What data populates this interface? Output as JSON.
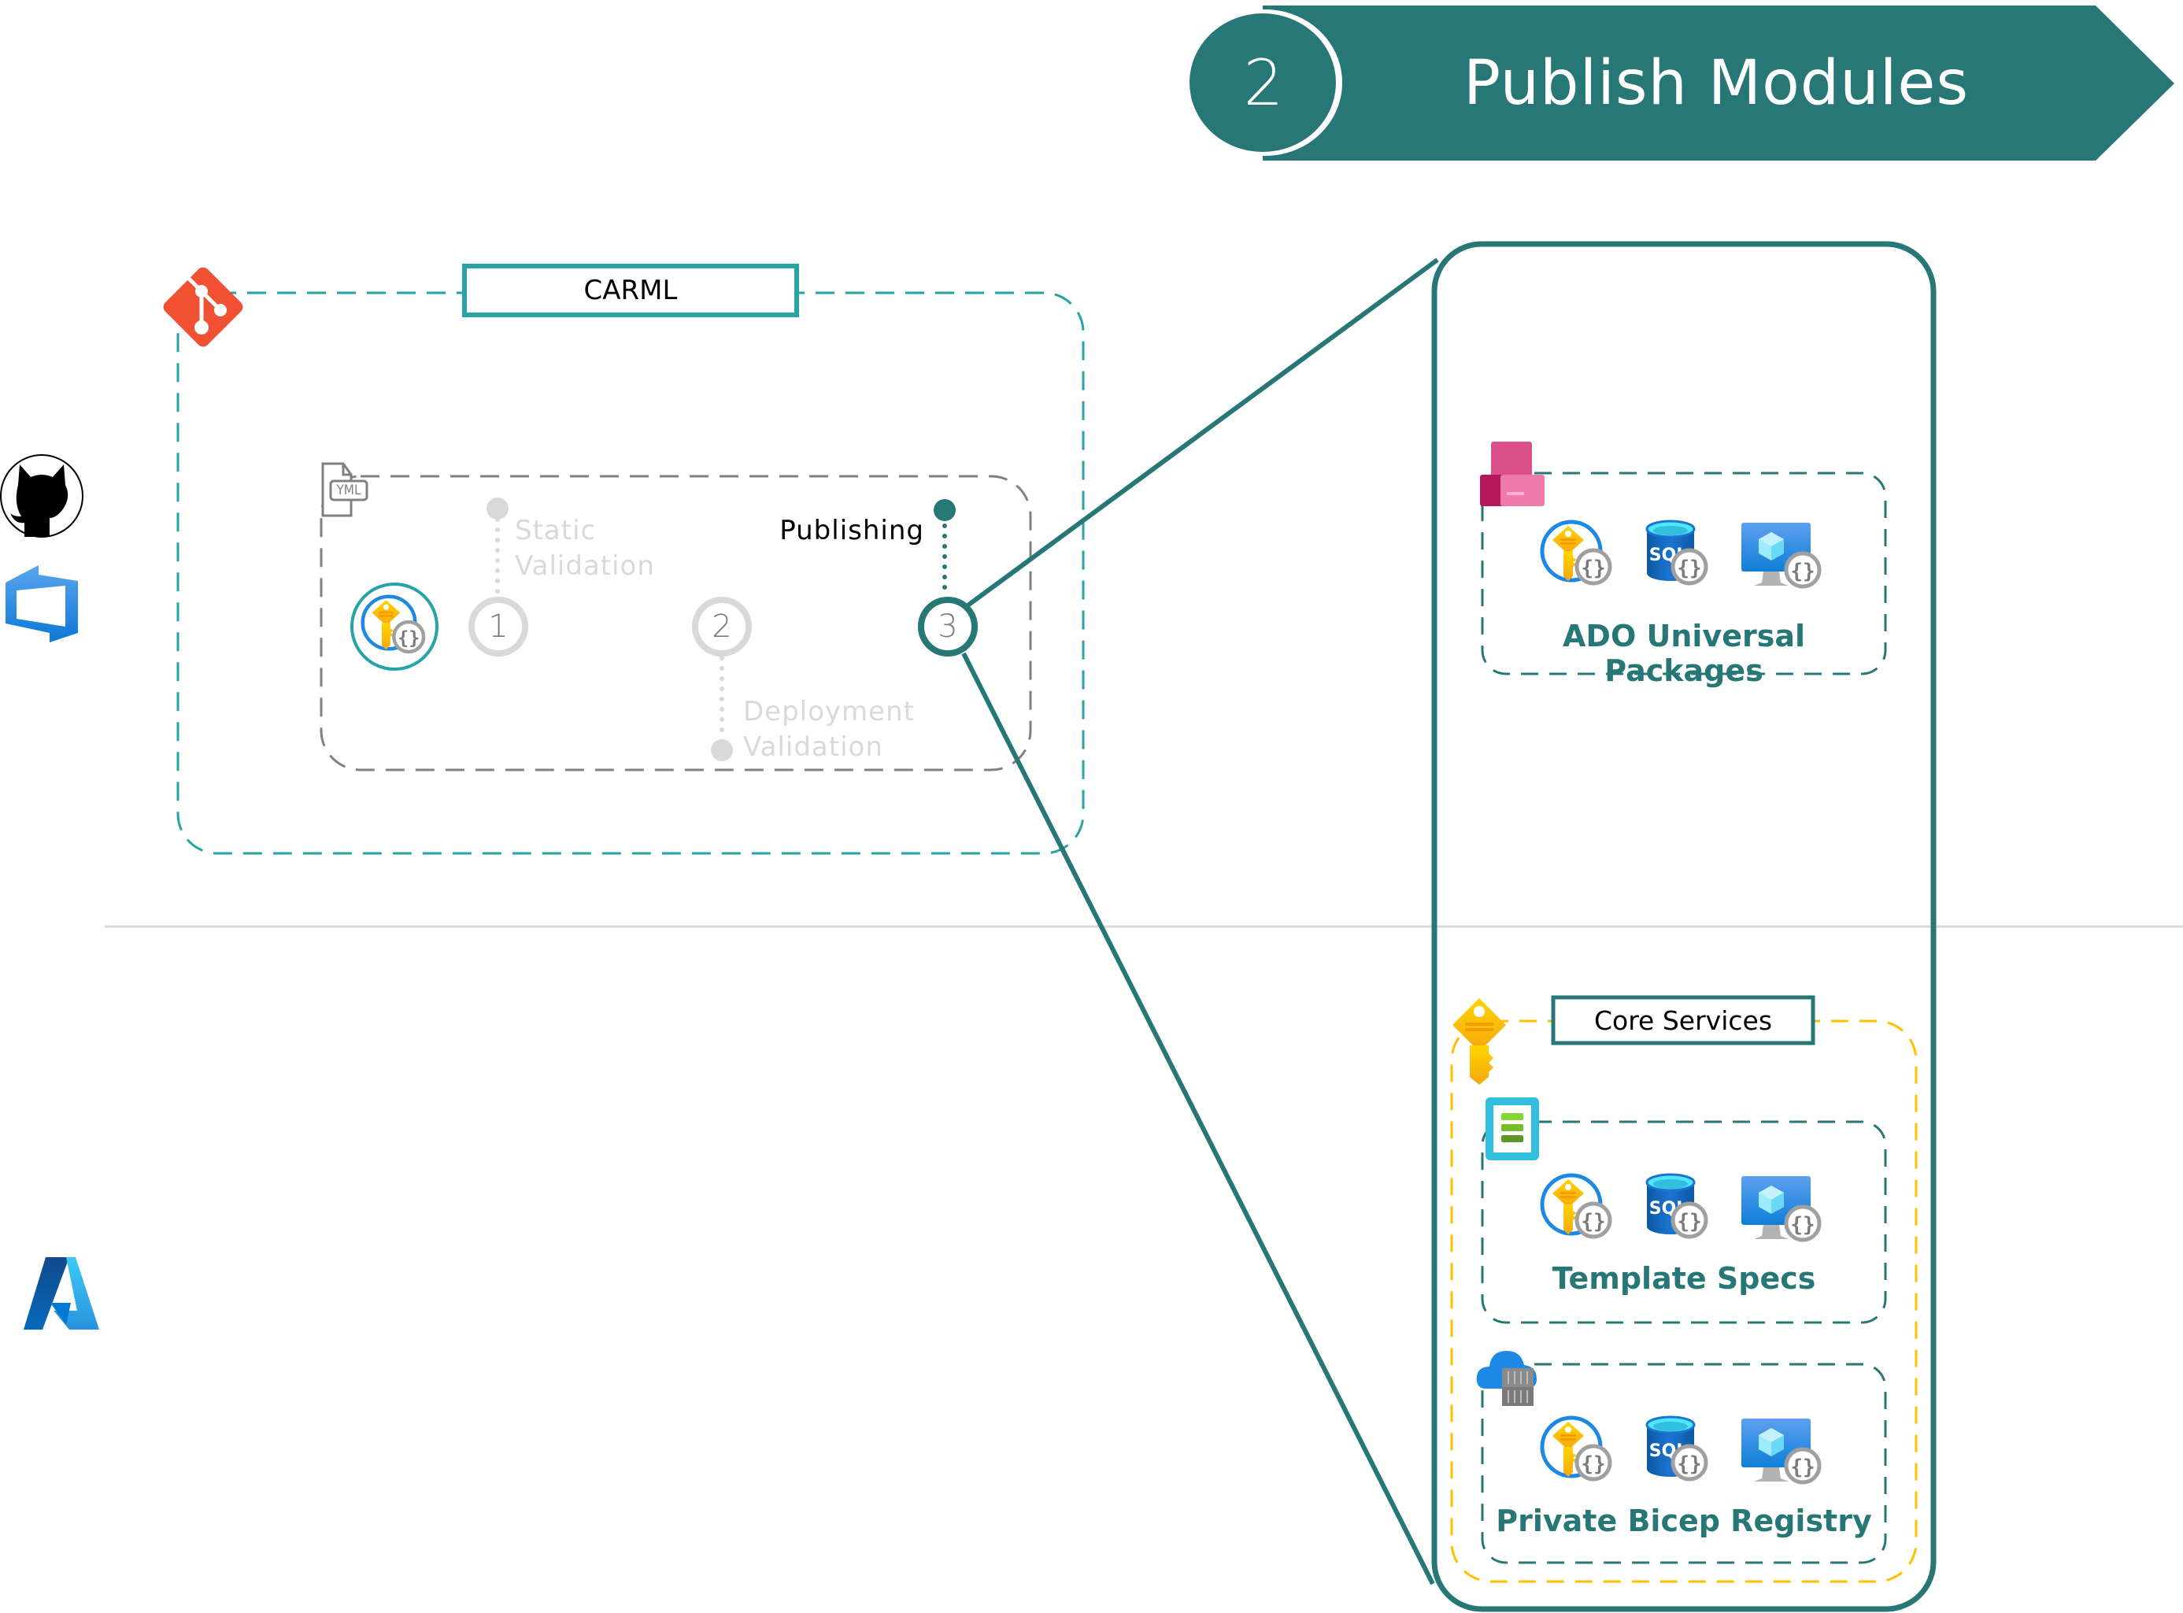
{
  "banner": {
    "step_number": "2",
    "title": "Publish Modules",
    "color": "#267776"
  },
  "platforms": {
    "icons": [
      "github-icon",
      "azure-devops-icon",
      "azure-icon"
    ]
  },
  "repository": {
    "label": "CARML",
    "icon": "git-icon",
    "border_color": "#26a3a5"
  },
  "pipeline": {
    "file_icon_label": "YML",
    "start_icon": "key-vault-bicep-module-icon",
    "stages": [
      {
        "number": "1",
        "name_line1": "Static",
        "name_line2": "Validation",
        "state": "inactive"
      },
      {
        "number": "2",
        "name_line1": "Deployment",
        "name_line2": "Validation",
        "state": "inactive"
      },
      {
        "number": "3",
        "name_line1": "Publishing",
        "name_line2": "",
        "state": "active"
      }
    ],
    "active_color": "#267776",
    "inactive_color": "#d9d9d9",
    "track_color": "#26a3a5"
  },
  "targets": {
    "ado": {
      "label": "ADO Universal Packages",
      "icon": "universal-packages-icon",
      "modules": [
        "key-vault-module-icon",
        "sql-module-icon",
        "virtual-machine-module-icon"
      ]
    },
    "core_services": {
      "label": "Core Services",
      "icon": "key-vault-icon",
      "border_color": "#ffc000"
    },
    "template_specs": {
      "label": "Template Specs",
      "icon": "template-specs-icon",
      "modules": [
        "key-vault-module-icon",
        "sql-module-icon",
        "virtual-machine-module-icon"
      ]
    },
    "bicep_registry": {
      "label": "Private Bicep Registry",
      "icon": "container-registry-icon",
      "modules": [
        "key-vault-module-icon",
        "sql-module-icon",
        "virtual-machine-module-icon"
      ]
    }
  },
  "module_badge_glyph": "{}",
  "sql_glyph": "SQL"
}
